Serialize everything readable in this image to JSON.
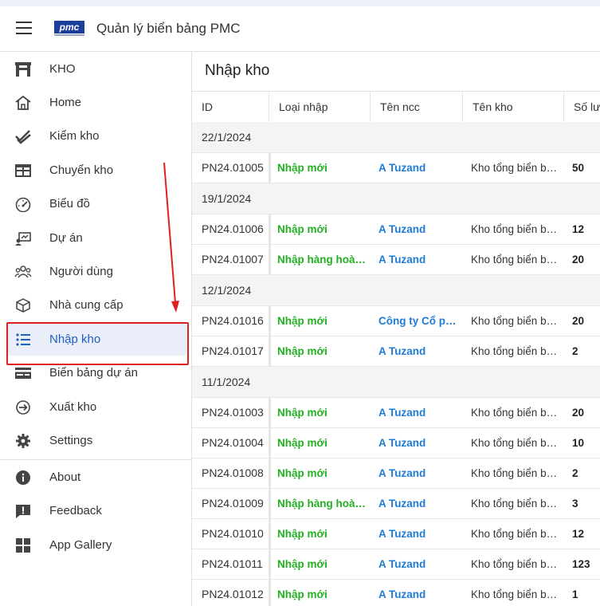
{
  "app": {
    "title": "Quản lý biển bảng PMC",
    "logo_text": "pmc"
  },
  "sidebar": {
    "items": [
      {
        "label": "KHO",
        "icon": "warehouse-icon"
      },
      {
        "label": "Home",
        "icon": "home-icon"
      },
      {
        "label": "Kiểm kho",
        "icon": "double-check-icon"
      },
      {
        "label": "Chuyển kho",
        "icon": "table-icon"
      },
      {
        "label": "Biểu đồ",
        "icon": "gauge-icon"
      },
      {
        "label": "Dự án",
        "icon": "project-icon"
      },
      {
        "label": "Người dùng",
        "icon": "users-icon"
      },
      {
        "label": "Nhà cung cấp",
        "icon": "box-icon"
      },
      {
        "label": "Nhập kho",
        "icon": "list-icon"
      },
      {
        "label": "Biển bảng dự án",
        "icon": "card-icon"
      },
      {
        "label": "Xuất kho",
        "icon": "arrow-circle-icon"
      },
      {
        "label": "Settings",
        "icon": "gear-icon"
      }
    ],
    "bottom_items": [
      {
        "label": "About",
        "icon": "info-icon"
      },
      {
        "label": "Feedback",
        "icon": "feedback-icon"
      },
      {
        "label": "App Gallery",
        "icon": "grid-icon"
      }
    ],
    "active_index": 8
  },
  "main": {
    "title": "Nhập kho",
    "columns": [
      "ID",
      "Loại nhập",
      "Tên ncc",
      "Tên kho",
      "Số lượ"
    ],
    "groups": [
      {
        "date": "22/1/2024",
        "rows": [
          {
            "id": "PN24.01005",
            "type": "Nhập mới",
            "ncc": "A Tuzand",
            "kho": "Kho tổng biển bả...",
            "qty": "50"
          }
        ]
      },
      {
        "date": "19/1/2024",
        "rows": [
          {
            "id": "PN24.01006",
            "type": "Nhập mới",
            "ncc": "A Tuzand",
            "kho": "Kho tổng biển bả...",
            "qty": "12"
          },
          {
            "id": "PN24.01007",
            "type": "Nhập hàng hoàn t...",
            "ncc": "A Tuzand",
            "kho": "Kho tổng biển bả...",
            "qty": "20"
          }
        ]
      },
      {
        "date": "12/1/2024",
        "rows": [
          {
            "id": "PN24.01016",
            "type": "Nhập mới",
            "ncc": "Công ty Cổ phầ...",
            "kho": "Kho tổng biển bả...",
            "qty": "20"
          },
          {
            "id": "PN24.01017",
            "type": "Nhập mới",
            "ncc": "A Tuzand",
            "kho": "Kho tổng biển bả...",
            "qty": "2"
          }
        ]
      },
      {
        "date": "11/1/2024",
        "rows": [
          {
            "id": "PN24.01003",
            "type": "Nhập mới",
            "ncc": "A Tuzand",
            "kho": "Kho tổng biển bả...",
            "qty": "20"
          },
          {
            "id": "PN24.01004",
            "type": "Nhập mới",
            "ncc": "A Tuzand",
            "kho": "Kho tổng biển bả...",
            "qty": "10"
          },
          {
            "id": "PN24.01008",
            "type": "Nhập mới",
            "ncc": "A Tuzand",
            "kho": "Kho tổng biển bả...",
            "qty": "2"
          },
          {
            "id": "PN24.01009",
            "type": "Nhập hàng hoàn t...",
            "ncc": "A Tuzand",
            "kho": "Kho tổng biển bả...",
            "qty": "3"
          },
          {
            "id": "PN24.01010",
            "type": "Nhập mới",
            "ncc": "A Tuzand",
            "kho": "Kho tổng biển bả...",
            "qty": "12"
          },
          {
            "id": "PN24.01011",
            "type": "Nhập mới",
            "ncc": "A Tuzand",
            "kho": "Kho tổng biển bả...",
            "qty": "123"
          },
          {
            "id": "PN24.01012",
            "type": "Nhập mới",
            "ncc": "A Tuzand",
            "kho": "Kho tổng biển bả...",
            "qty": "1"
          }
        ]
      }
    ]
  },
  "colors": {
    "type_green": "#22b022",
    "ncc_blue": "#1f7ad6",
    "active_bg": "#e9eef8",
    "annotation_red": "#e02020"
  }
}
